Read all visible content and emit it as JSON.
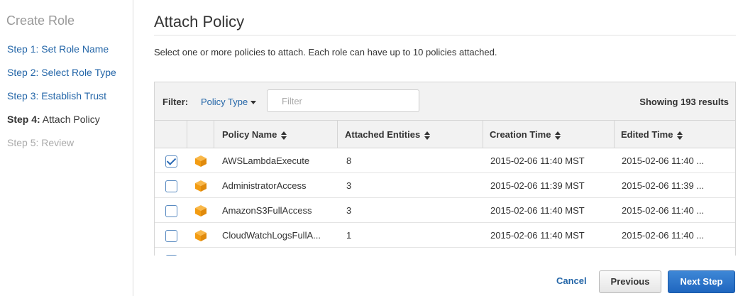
{
  "sidebar": {
    "title": "Create Role",
    "steps": [
      {
        "prefix": "",
        "label": "Step 1: Set Role Name"
      },
      {
        "prefix": "",
        "label": "Step 2: Select Role Type"
      },
      {
        "prefix": "",
        "label": "Step 3: Establish Trust"
      },
      {
        "prefix": "Step 4:",
        "label": " Attach Policy"
      },
      {
        "prefix": "",
        "label": "Step 5: Review"
      }
    ]
  },
  "main": {
    "title": "Attach Policy",
    "intro": "Select one or more policies to attach. Each role can have up to 10 policies attached."
  },
  "filter": {
    "label": "Filter:",
    "policy_type": "Policy Type",
    "placeholder": "Filter",
    "results": "Showing 193 results"
  },
  "table": {
    "columns": [
      "Policy Name",
      "Attached Entities",
      "Creation Time",
      "Edited Time"
    ],
    "rows": [
      {
        "checked": true,
        "name": "AWSLambdaExecute",
        "entities": "8",
        "created": "2015-02-06 11:40 MST",
        "edited": "2015-02-06 11:40 ..."
      },
      {
        "checked": false,
        "name": "AdministratorAccess",
        "entities": "3",
        "created": "2015-02-06 11:39 MST",
        "edited": "2015-02-06 11:39 ..."
      },
      {
        "checked": false,
        "name": "AmazonS3FullAccess",
        "entities": "3",
        "created": "2015-02-06 11:40 MST",
        "edited": "2015-02-06 11:40 ..."
      },
      {
        "checked": false,
        "name": "CloudWatchLogsFullA...",
        "entities": "1",
        "created": "2015-02-06 11:40 MST",
        "edited": "2015-02-06 11:40 ..."
      }
    ]
  },
  "buttons": {
    "cancel": "Cancel",
    "previous": "Previous",
    "next": "Next Step"
  },
  "colors": {
    "link": "#2466a8",
    "primary": "#2a75c9",
    "icon": "#f7a020"
  },
  "icons": {
    "policy": "orange-cube-icon"
  }
}
